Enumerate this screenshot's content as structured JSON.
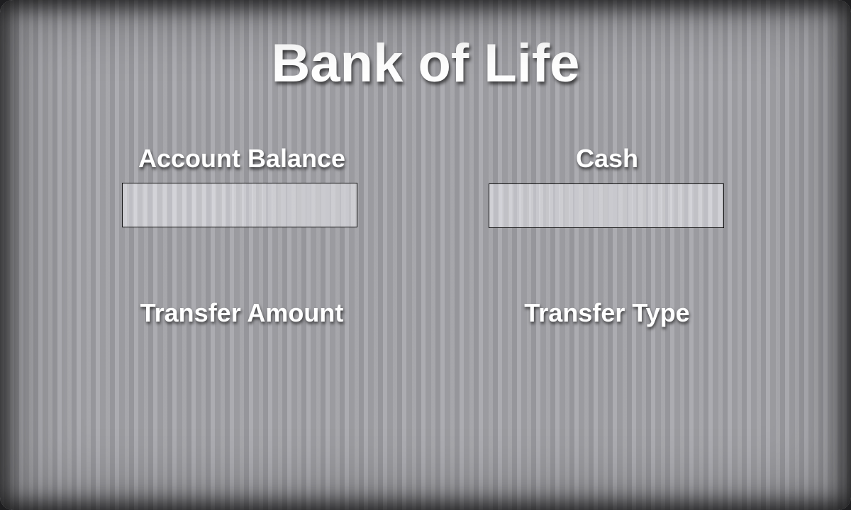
{
  "app": {
    "title": "Bank of Life"
  },
  "fields": {
    "account_balance": {
      "label": "Account Balance",
      "value": ""
    },
    "cash": {
      "label": "Cash",
      "value": ""
    }
  },
  "transfer": {
    "amount_label": "Transfer Amount",
    "type_label": "Transfer Type"
  },
  "colors": {
    "background": "#a3a3a8",
    "text": "#ffffff",
    "field_border": "#111111"
  }
}
